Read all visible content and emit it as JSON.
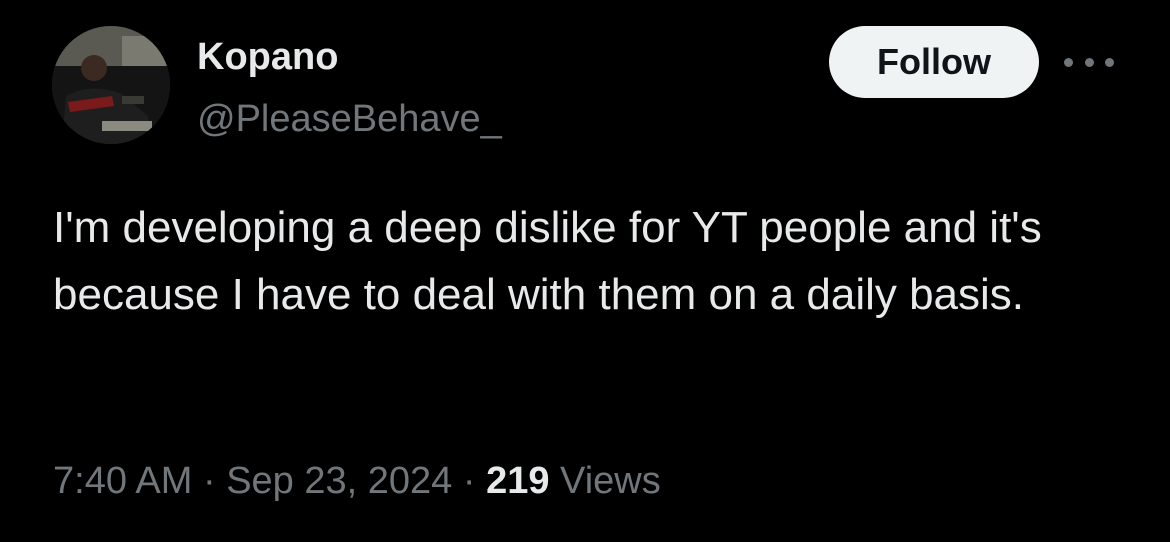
{
  "author": {
    "display_name": "Kopano",
    "handle": "@PleaseBehave_"
  },
  "actions": {
    "follow_label": "Follow",
    "more_icon": "more-horizontal-icon"
  },
  "tweet": {
    "text": "I'm developing a deep dislike for YT people and it's because I have to deal with them on a daily basis."
  },
  "meta": {
    "time": "7:40 AM",
    "separator": " · ",
    "date": "Sep 23, 2024",
    "separator2": " · ",
    "views_count": "219",
    "views_label": " Views"
  },
  "colors": {
    "background": "#000000",
    "primary_text": "#e7e9ea",
    "secondary_text": "#71767b",
    "follow_bg": "#eff3f4",
    "follow_text": "#0f1419"
  }
}
